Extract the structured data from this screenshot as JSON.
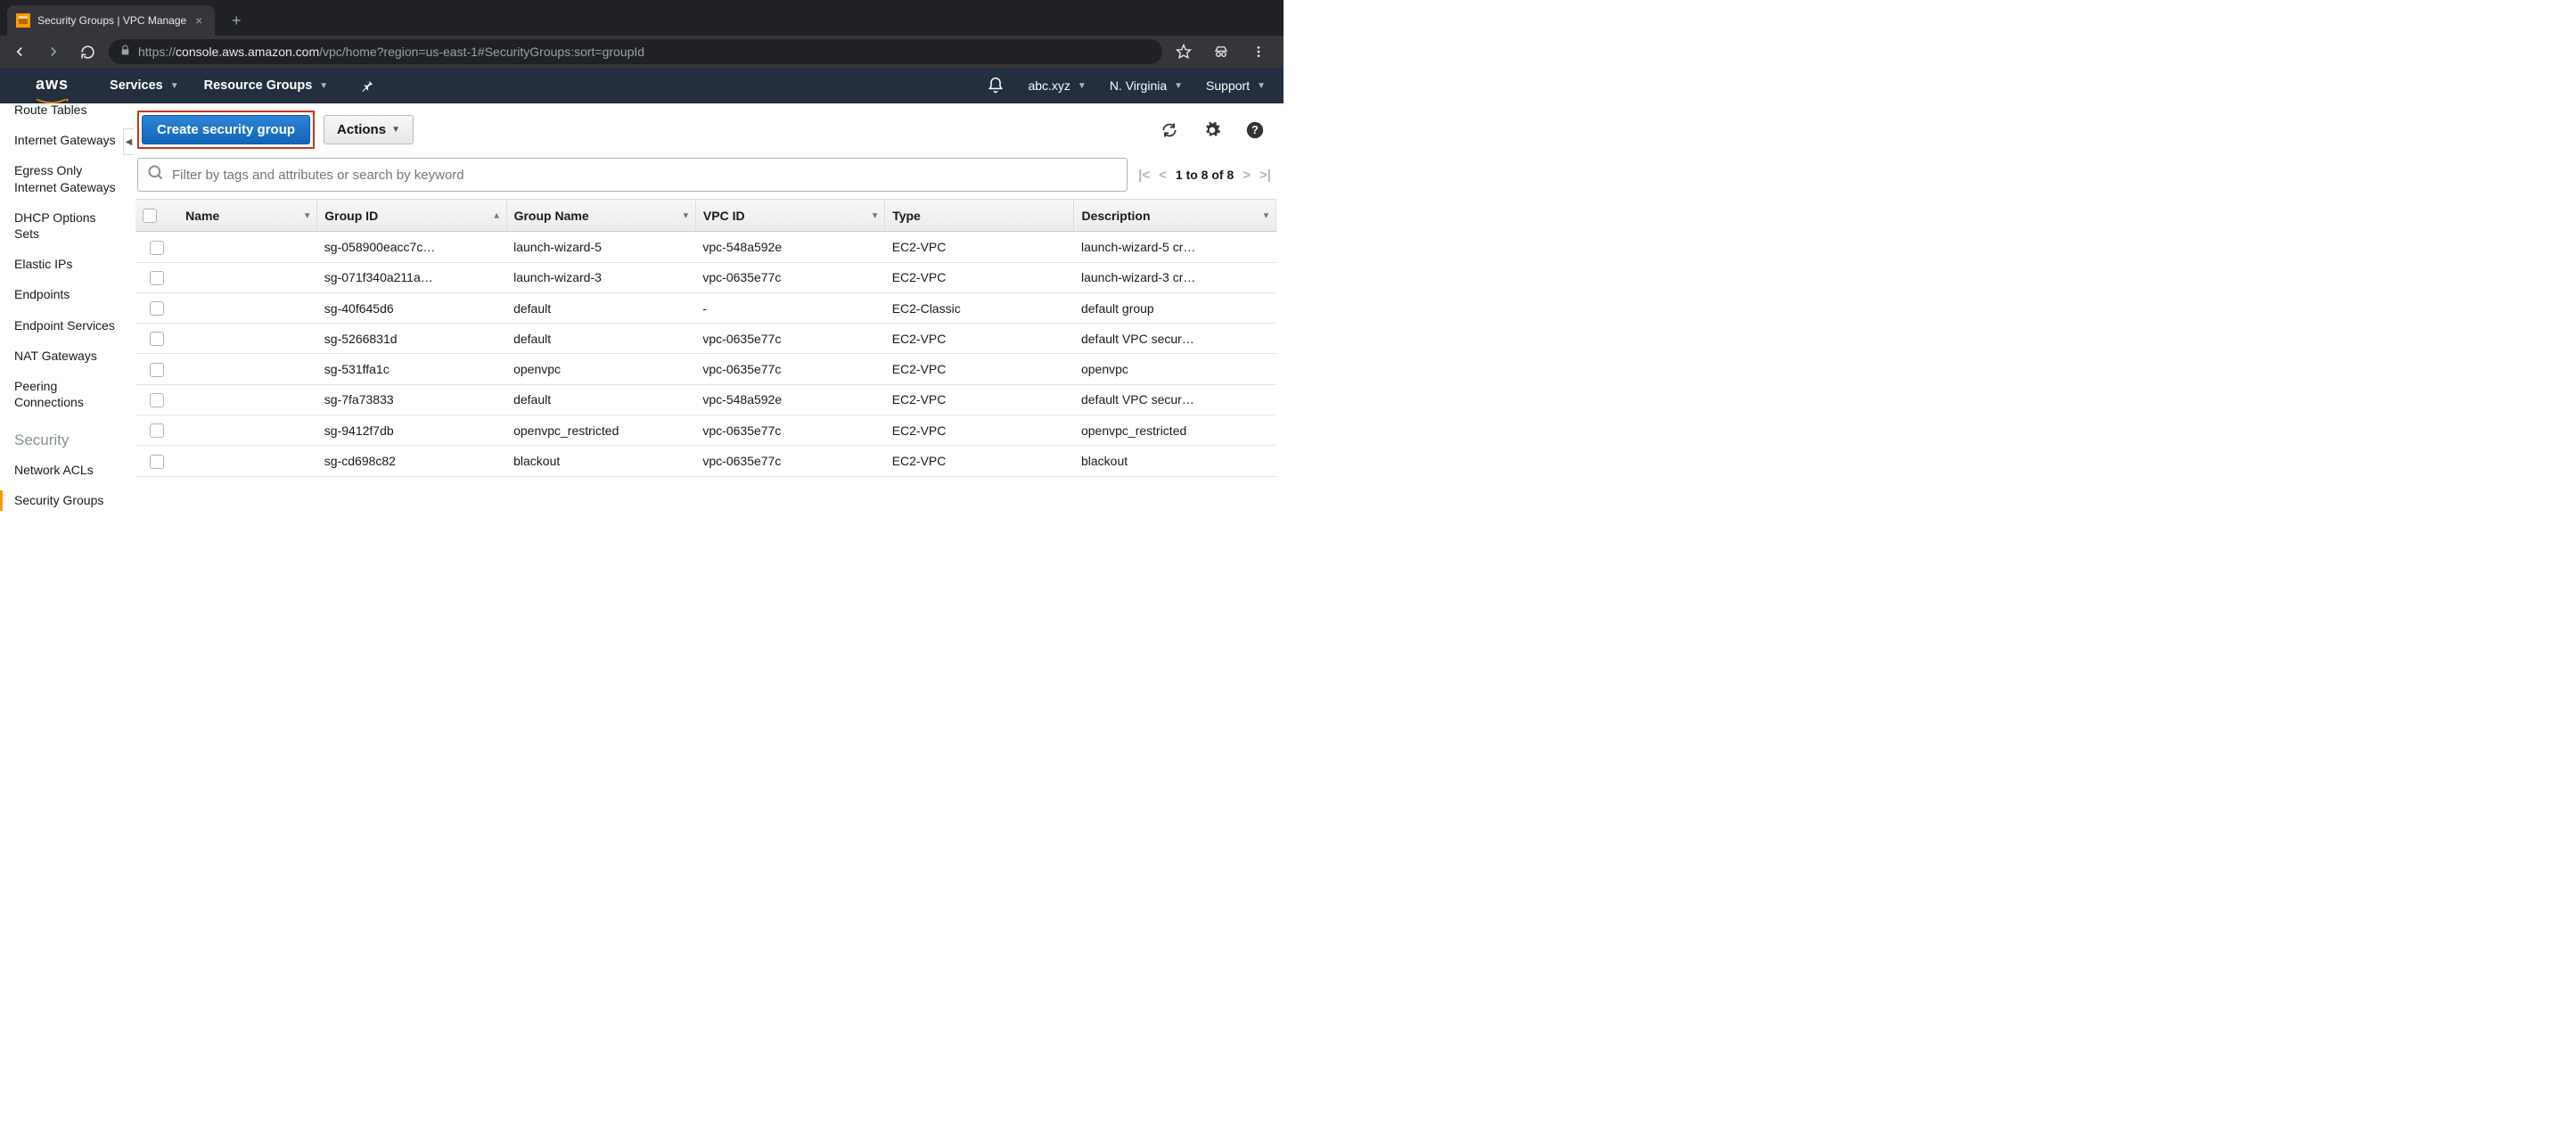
{
  "browser": {
    "tab_title": "Security Groups | VPC Manage",
    "url_host": "console.aws.amazon.com",
    "url_path": "/vpc/home?region=us-east-1#SecurityGroups:sort=groupId",
    "url_scheme": "https://"
  },
  "header": {
    "services": "Services",
    "resource_groups": "Resource Groups",
    "account": "abc.xyz",
    "region": "N. Virginia",
    "support": "Support"
  },
  "sidebar": {
    "items_top": [
      "Route Tables",
      "Internet Gateways",
      "Egress Only Internet Gateways",
      "DHCP Options Sets",
      "Elastic IPs",
      "Endpoints",
      "Endpoint Services",
      "NAT Gateways",
      "Peering Connections"
    ],
    "section_heading": "Security",
    "items_security": [
      "Network ACLs",
      "Security Groups"
    ]
  },
  "actions": {
    "create": "Create security group",
    "actions": "Actions"
  },
  "filter": {
    "placeholder": "Filter by tags and attributes or search by keyword"
  },
  "pager": {
    "text": "1 to 8 of 8"
  },
  "columns": [
    "Name",
    "Group ID",
    "Group Name",
    "VPC ID",
    "Type",
    "Description"
  ],
  "rows": [
    {
      "name": "",
      "group_id": "sg-058900eacc7c…",
      "group_name": "launch-wizard-5",
      "vpc_id": "vpc-548a592e",
      "type": "EC2-VPC",
      "description": "launch-wizard-5 cr…"
    },
    {
      "name": "",
      "group_id": "sg-071f340a211a…",
      "group_name": "launch-wizard-3",
      "vpc_id": "vpc-0635e77c",
      "type": "EC2-VPC",
      "description": "launch-wizard-3 cr…"
    },
    {
      "name": "",
      "group_id": "sg-40f645d6",
      "group_name": "default",
      "vpc_id": "-",
      "type": "EC2-Classic",
      "description": "default group"
    },
    {
      "name": "",
      "group_id": "sg-5266831d",
      "group_name": "default",
      "vpc_id": "vpc-0635e77c",
      "type": "EC2-VPC",
      "description": "default VPC secur…"
    },
    {
      "name": "",
      "group_id": "sg-531ffa1c",
      "group_name": "openvpc",
      "vpc_id": "vpc-0635e77c",
      "type": "EC2-VPC",
      "description": "openvpc"
    },
    {
      "name": "",
      "group_id": "sg-7fa73833",
      "group_name": "default",
      "vpc_id": "vpc-548a592e",
      "type": "EC2-VPC",
      "description": "default VPC secur…"
    },
    {
      "name": "",
      "group_id": "sg-9412f7db",
      "group_name": "openvpc_restricted",
      "vpc_id": "vpc-0635e77c",
      "type": "EC2-VPC",
      "description": "openvpc_restricted"
    },
    {
      "name": "",
      "group_id": "sg-cd698c82",
      "group_name": "blackout",
      "vpc_id": "vpc-0635e77c",
      "type": "EC2-VPC",
      "description": "blackout"
    }
  ]
}
